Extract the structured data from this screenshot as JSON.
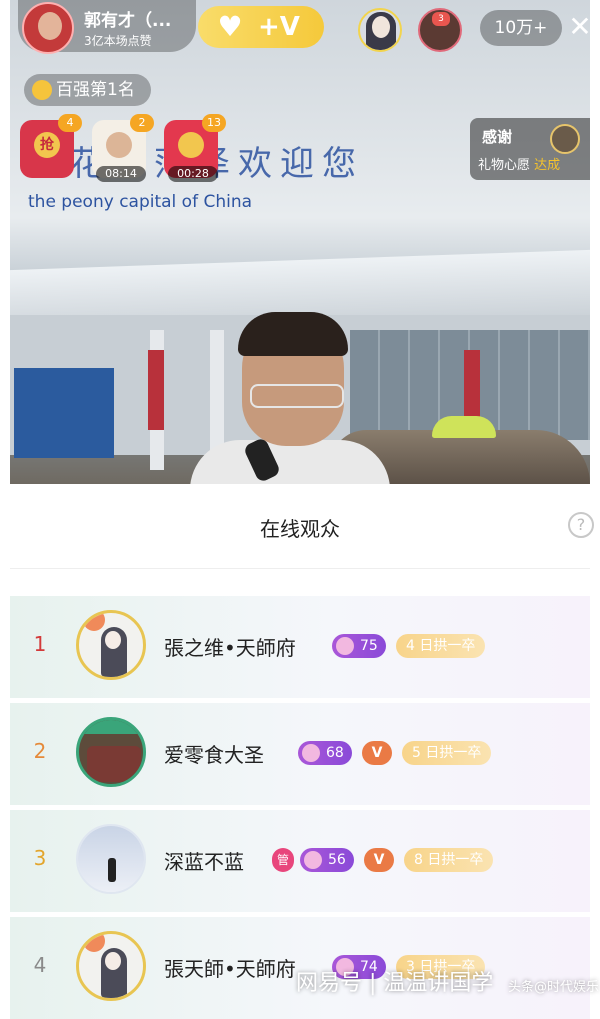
{
  "stage": {
    "sign_cn": "花都菏泽欢迎您",
    "sign_en": "the peony capital of China"
  },
  "host": {
    "name": "郭有才（...",
    "likes": "3亿本场点赞"
  },
  "hud": {
    "heart_label": "♥",
    "vplus_label": "+V",
    "viewer_count": "10万+",
    "close_label": "✕",
    "top_viewer_2_badge": "3"
  },
  "rank_tag": "百强第1名",
  "redpacks": [
    {
      "count": "4",
      "label": "抢",
      "time": ""
    },
    {
      "count": "2",
      "label": "",
      "time": "08:14"
    },
    {
      "count": "13",
      "label": "",
      "time": "00:28"
    }
  ],
  "thanks": {
    "title": "感谢",
    "subtitle": "礼物心愿",
    "status": "达成"
  },
  "sheet": {
    "title": "在线观众",
    "help_label": "?"
  },
  "audience": [
    {
      "rank": "1",
      "name": "張之维•天師府",
      "level": "75",
      "fan": "4  日拱一卒",
      "rank_color": "#d33a3a"
    },
    {
      "rank": "2",
      "name": "爱零食大圣",
      "level": "68",
      "vip": "V",
      "fan": "5  日拱一卒",
      "rank_color": "#e58a3a"
    },
    {
      "rank": "3",
      "name": "深蓝不蓝",
      "guan": "管",
      "level": "56",
      "vip": "V",
      "fan": "8  日拱一卒",
      "rank_color": "#e3a52c"
    },
    {
      "rank": "4",
      "name": "張天師•天師府",
      "level": "74",
      "fan": "3  日拱一卒",
      "rank_color": "#8a8a8a"
    }
  ],
  "watermark": {
    "main": "网易号 | 温温讲国学",
    "sub": "头条@时代娱乐"
  },
  "colors": {
    "accent_gold": "#f5c93b",
    "level_purple": "#a957d8",
    "vip_orange": "#ea7a45"
  }
}
